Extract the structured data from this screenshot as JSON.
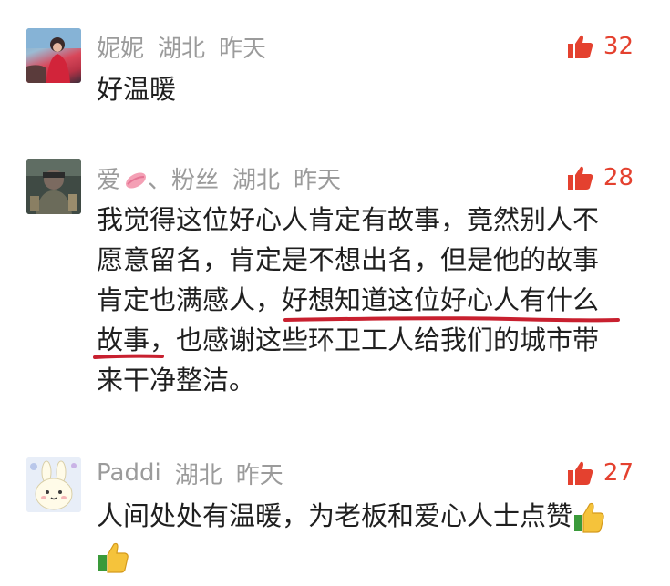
{
  "comments": [
    {
      "user": "妮妮",
      "location": "湖北",
      "time": "昨天",
      "likes": "32",
      "text": "好温暖"
    },
    {
      "user": "爱",
      "user_suffix": "、粉丝",
      "location": "湖北",
      "time": "昨天",
      "likes": "28",
      "line1": "我觉得这位好心人肯定有故事，竟然别人不",
      "line2": "愿意留名，肯定是不想出名，但是他的故事",
      "line3_a": "肯定也满感人，",
      "line3_b": "好想知道这位好心人有什么",
      "line4_a": "故事，",
      "line4_b": "也感谢这些环卫工人给我们的城市带",
      "line5": "来干净整洁。"
    },
    {
      "user": "Paddi",
      "location": "湖北",
      "time": "昨天",
      "likes": "27",
      "text": "人间处处有温暖，为老板和爱心人士点赞"
    }
  ],
  "icons": {
    "like": "thumbs-up-icon",
    "emoji_thumb": "thumbs-up-emoji-icon",
    "lips": "kiss-lips-icon"
  },
  "colors": {
    "like": "#e4412f",
    "meta": "#9b9b9b",
    "underline": "#c8202f"
  }
}
